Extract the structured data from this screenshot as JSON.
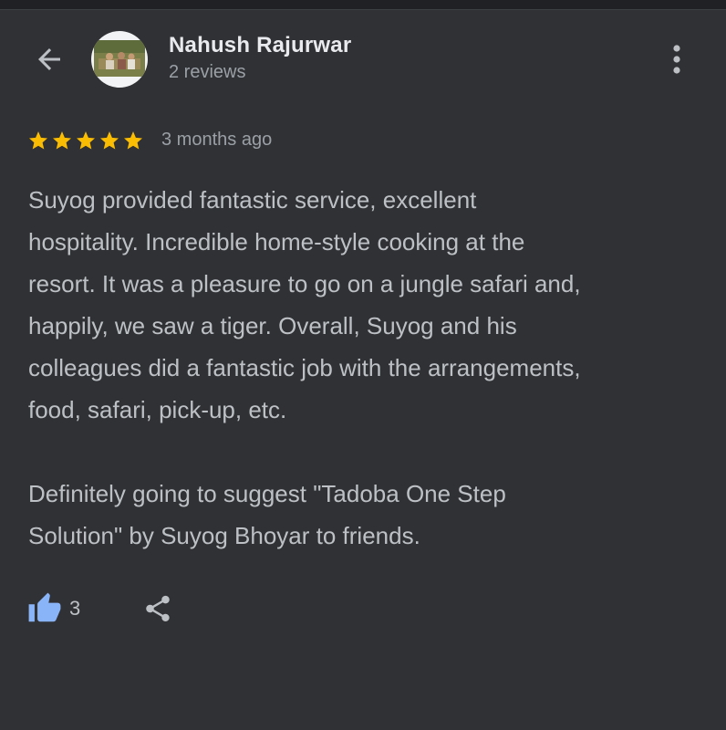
{
  "header": {
    "back_icon": "arrow-left-icon",
    "reviewer_name": "Nahush Rajurwar",
    "reviewer_sub": "2 reviews",
    "more_icon": "more-vertical-icon"
  },
  "review": {
    "rating": 5,
    "rating_max": 5,
    "star_color": "#fbbc04",
    "time_ago": "3 months ago",
    "text": "Suyog provided fantastic service, excellent\nhospitality. Incredible home-style cooking at the\nresort. It was a pleasure to go on a jungle safari and,\nhappily, we saw a tiger. Overall, Suyog and his\ncolleagues did a fantastic job with the arrangements,\nfood, safari, pick-up, etc.\n\nDefinitely going to suggest \"Tadoba One Step\nSolution\" by Suyog Bhoyar to friends."
  },
  "actions": {
    "like_icon": "thumbs-up-icon",
    "like_count": "3",
    "like_color": "#8ab4f8",
    "share_icon": "share-icon"
  },
  "colors": {
    "background": "#303134",
    "primary_text": "#e8eaed",
    "secondary_text": "#9aa0a6"
  }
}
